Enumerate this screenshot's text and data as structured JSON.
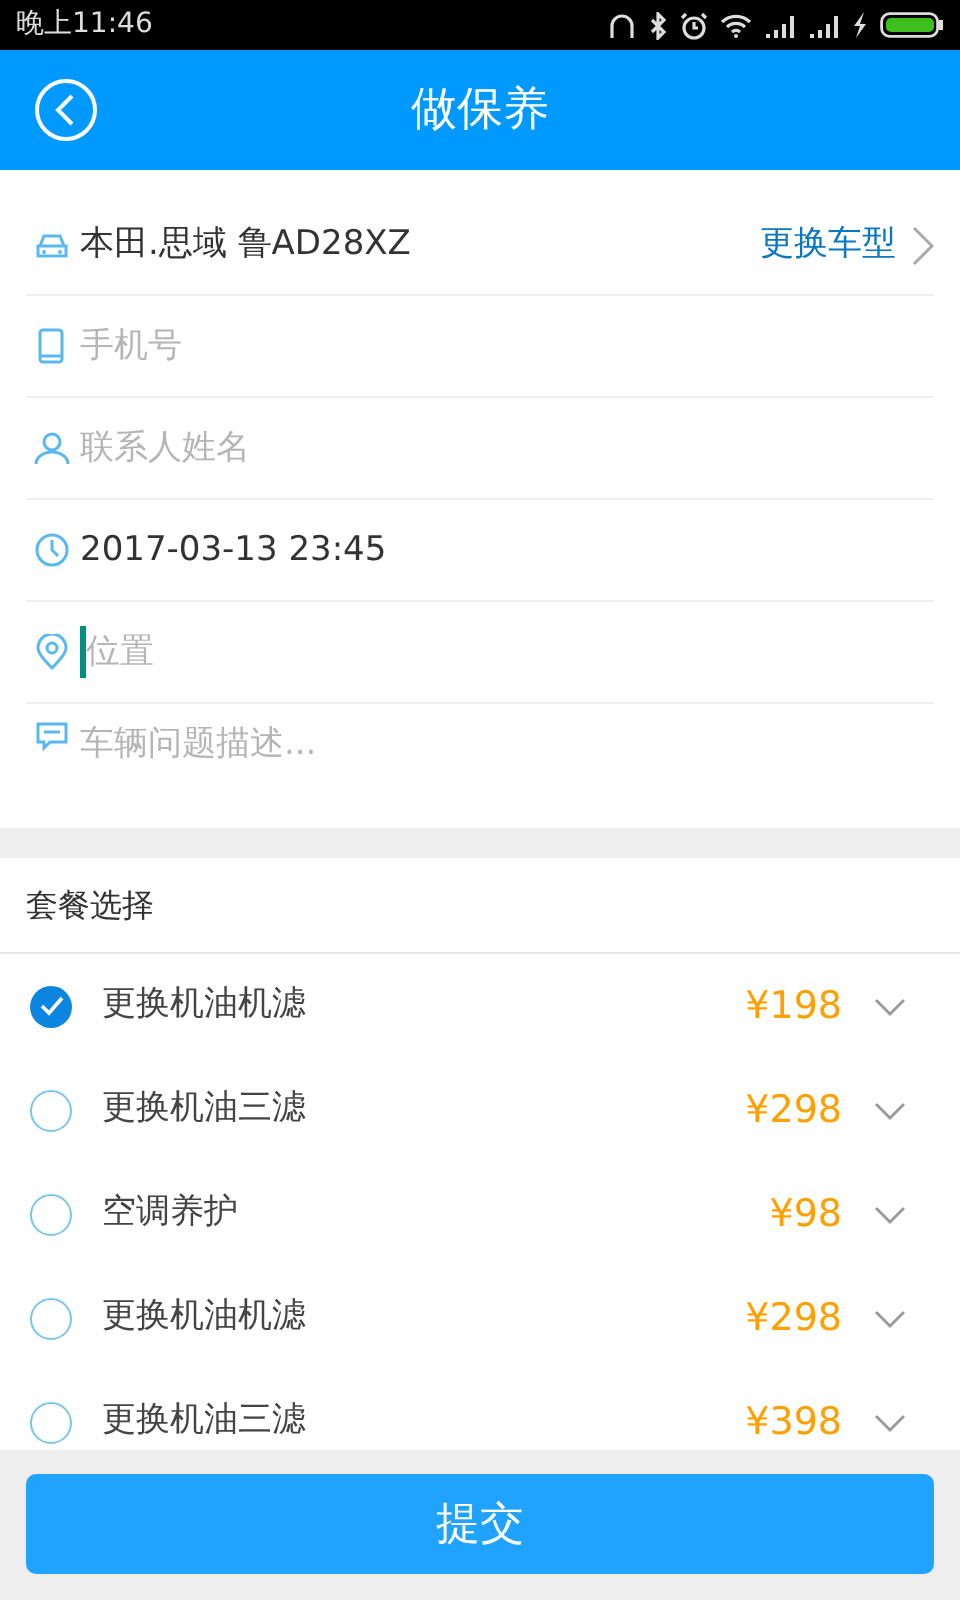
{
  "status_bar": {
    "time": "晚上11:46"
  },
  "header": {
    "title": "做保养"
  },
  "vehicle": {
    "name": "本田.思域 鲁AD28XZ",
    "action": "更换车型"
  },
  "fields": [
    {
      "kind": "phone",
      "placeholder": "手机号"
    },
    {
      "kind": "person",
      "placeholder": "联系人姓名"
    },
    {
      "kind": "time",
      "value": "2017-03-13 23:45"
    },
    {
      "kind": "location",
      "placeholder": "位置",
      "focused": true
    },
    {
      "kind": "note",
      "placeholder": "车辆问题描述..."
    }
  ],
  "packages": {
    "title": "套餐选择",
    "items": [
      {
        "name": "更换机油机滤",
        "price": "¥198",
        "selected": true
      },
      {
        "name": "更换机油三滤",
        "price": "¥298",
        "selected": false
      },
      {
        "name": "空调养护",
        "price": "¥98",
        "selected": false
      },
      {
        "name": "更换机油机滤",
        "price": "¥298",
        "selected": false
      },
      {
        "name": "更换机油三滤",
        "price": "¥398",
        "selected": false
      }
    ]
  },
  "submit": {
    "label": "提交"
  }
}
